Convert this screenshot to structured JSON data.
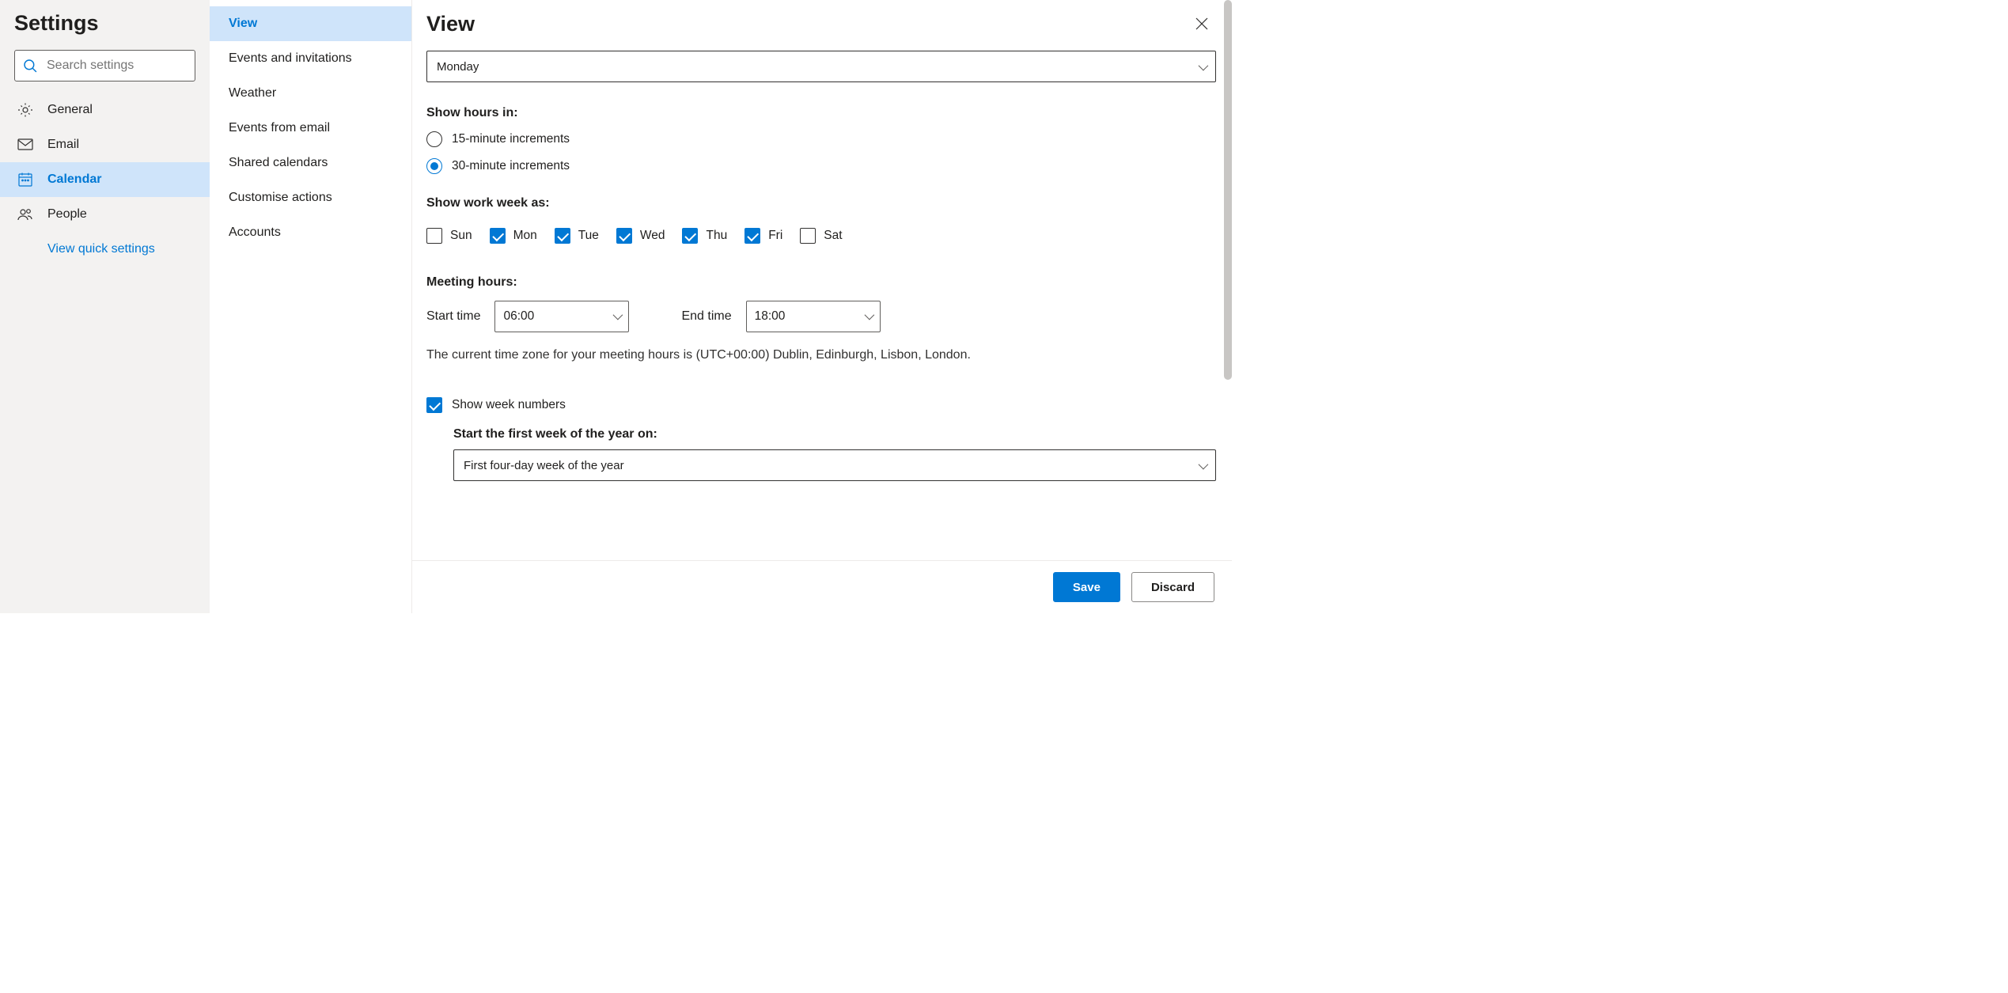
{
  "left": {
    "title": "Settings",
    "search_placeholder": "Search settings",
    "items": [
      {
        "label": "General"
      },
      {
        "label": "Email"
      },
      {
        "label": "Calendar",
        "active": true
      },
      {
        "label": "People"
      }
    ],
    "quick_link": "View quick settings"
  },
  "mid": {
    "items": [
      {
        "label": "View",
        "active": true
      },
      {
        "label": "Events and invitations"
      },
      {
        "label": "Weather"
      },
      {
        "label": "Events from email"
      },
      {
        "label": "Shared calendars"
      },
      {
        "label": "Customise actions"
      },
      {
        "label": "Accounts"
      }
    ]
  },
  "main": {
    "title": "View",
    "week_start_value": "Monday",
    "section_hours": "Show hours in:",
    "radio_15": "15-minute increments",
    "radio_30": "30-minute increments",
    "radio_selected": "30",
    "section_workweek": "Show work week as:",
    "days": [
      {
        "label": "Sun",
        "checked": false
      },
      {
        "label": "Mon",
        "checked": true
      },
      {
        "label": "Tue",
        "checked": true
      },
      {
        "label": "Wed",
        "checked": true
      },
      {
        "label": "Thu",
        "checked": true
      },
      {
        "label": "Fri",
        "checked": true
      },
      {
        "label": "Sat",
        "checked": false
      }
    ],
    "section_meeting": "Meeting hours:",
    "start_label": "Start time",
    "start_value": "06:00",
    "end_label": "End time",
    "end_value": "18:00",
    "tz_note": "The current time zone for your meeting hours is (UTC+00:00) Dublin, Edinburgh, Lisbon, London.",
    "show_week_numbers_label": "Show week numbers",
    "show_week_numbers_checked": true,
    "first_week_label": "Start the first week of the year on:",
    "first_week_value": "First four-day week of the year"
  },
  "footer": {
    "save": "Save",
    "discard": "Discard"
  }
}
